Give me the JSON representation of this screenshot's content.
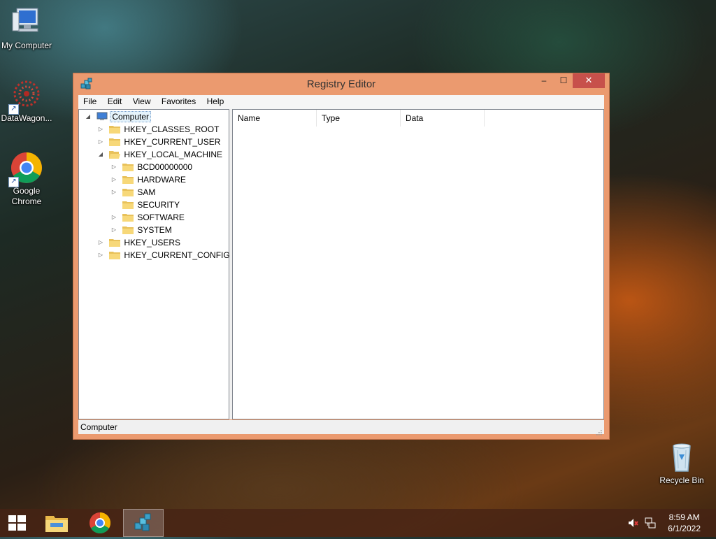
{
  "desktop": {
    "icons": [
      {
        "label": "My Computer"
      },
      {
        "label": "DataWagon..."
      },
      {
        "label": "Google Chrome"
      },
      {
        "label": "Recycle Bin"
      }
    ]
  },
  "window": {
    "title": "Registry Editor",
    "controls": {
      "minimize": "–",
      "maximize": "☐",
      "close": "✕"
    },
    "menu": [
      "File",
      "Edit",
      "View",
      "Favorites",
      "Help"
    ],
    "tree": [
      {
        "label": "Computer",
        "expander": "◢",
        "selected": true
      },
      {
        "label": "HKEY_CLASSES_ROOT",
        "expander": "▷"
      },
      {
        "label": "HKEY_CURRENT_USER",
        "expander": "▷"
      },
      {
        "label": "HKEY_LOCAL_MACHINE",
        "expander": "◢"
      },
      {
        "label": "BCD00000000",
        "expander": "▷"
      },
      {
        "label": "HARDWARE",
        "expander": "▷"
      },
      {
        "label": "SAM",
        "expander": "▷"
      },
      {
        "label": "SECURITY",
        "expander": ""
      },
      {
        "label": "SOFTWARE",
        "expander": "▷"
      },
      {
        "label": "SYSTEM",
        "expander": "▷"
      },
      {
        "label": "HKEY_USERS",
        "expander": "▷"
      },
      {
        "label": "HKEY_CURRENT_CONFIG",
        "expander": "▷"
      }
    ],
    "columns": [
      "Name",
      "Type",
      "Data"
    ],
    "status": "Computer"
  },
  "taskbar": {
    "items": [
      {
        "icon": "windows-start-icon"
      },
      {
        "icon": "file-explorer-icon"
      },
      {
        "icon": "chrome-icon"
      },
      {
        "icon": "regedit-icon",
        "active": true
      }
    ],
    "tray": {
      "volume_icon": "muted-speaker-icon",
      "network_icon": "network-icon"
    },
    "clock": {
      "time": "8:59 AM",
      "date": "6/1/2022"
    }
  },
  "colors": {
    "window_frame": "#eb9a6f",
    "close_button": "#c7504b",
    "selection": "#e5f3fb"
  }
}
